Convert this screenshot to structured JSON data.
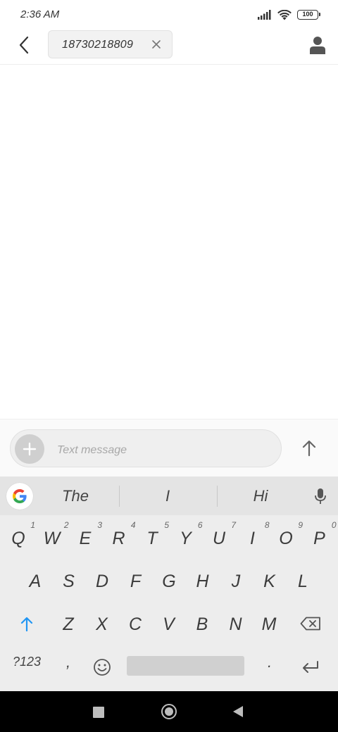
{
  "status_bar": {
    "time": "2:36 AM",
    "battery": "100",
    "icons": [
      "signal-icon",
      "wifi-icon",
      "battery-icon"
    ]
  },
  "header": {
    "recipient": "18730218809",
    "icons": [
      "back-arrow-icon",
      "close-icon",
      "contact-person-icon"
    ]
  },
  "compose": {
    "placeholder": "Text message",
    "icons": [
      "plus-icon",
      "send-arrow-up-icon"
    ]
  },
  "keyboard": {
    "suggestions": [
      "The",
      "I",
      "Hi"
    ],
    "rows": [
      [
        {
          "label": "Q",
          "hint": "1"
        },
        {
          "label": "W",
          "hint": "2"
        },
        {
          "label": "E",
          "hint": "3"
        },
        {
          "label": "R",
          "hint": "4"
        },
        {
          "label": "T",
          "hint": "5"
        },
        {
          "label": "Y",
          "hint": "6"
        },
        {
          "label": "U",
          "hint": "7"
        },
        {
          "label": "I",
          "hint": "8"
        },
        {
          "label": "O",
          "hint": "9"
        },
        {
          "label": "P",
          "hint": "0"
        }
      ],
      [
        {
          "label": "A"
        },
        {
          "label": "S"
        },
        {
          "label": "D"
        },
        {
          "label": "F"
        },
        {
          "label": "G"
        },
        {
          "label": "H"
        },
        {
          "label": "J"
        },
        {
          "label": "K"
        },
        {
          "label": "L"
        }
      ],
      [
        {
          "label": "Z"
        },
        {
          "label": "X"
        },
        {
          "label": "C"
        },
        {
          "label": "V"
        },
        {
          "label": "B"
        },
        {
          "label": "N"
        },
        {
          "label": "M"
        }
      ]
    ],
    "symbols_label": "?123",
    "comma_label": ",",
    "period_label": ".",
    "icons": [
      "google-g-icon",
      "mic-icon",
      "shift-icon",
      "backspace-icon",
      "emoji-icon",
      "enter-icon"
    ]
  },
  "nav_bar": {
    "icons": [
      "recent-apps-icon",
      "home-icon",
      "back-triangle-icon"
    ]
  }
}
